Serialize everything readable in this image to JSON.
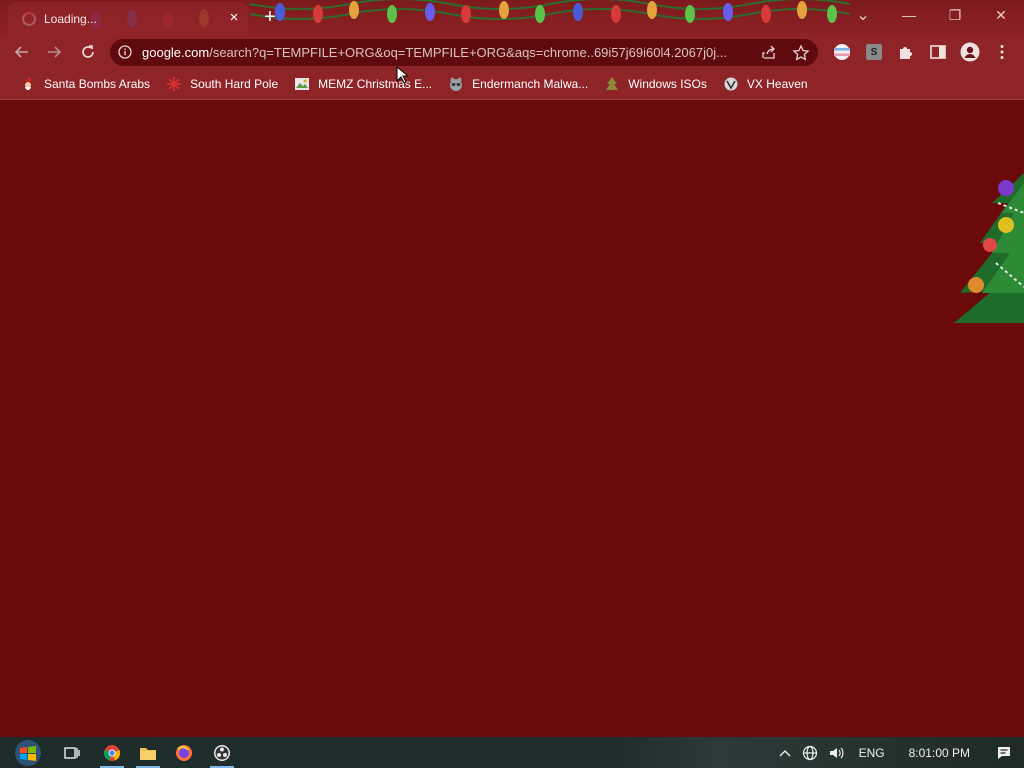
{
  "browser": {
    "tab": {
      "title": "Loading...",
      "close_glyph": "×"
    },
    "new_tab_glyph": "+",
    "window_controls": {
      "tab_search": "⌄",
      "minimize": "—",
      "restore": "❐",
      "close": "✕"
    },
    "address_bar": {
      "host": "google.com",
      "path": "/search?q=TEMPFILE+ORG&oq=TEMPFILE+ORG&aqs=chrome..69i57j69i60l4.2067j0j..."
    },
    "toolbar_icons": [
      "back-icon",
      "forward-icon",
      "stop-loading-icon",
      "site-info-icon",
      "share-icon",
      "bookmark-star-icon",
      "extension-flag-icon",
      "extension-s-icon",
      "extensions-puzzle-icon",
      "side-panel-icon",
      "profile-icon",
      "menu-icon"
    ],
    "extension_s_label": "S",
    "bookmarks": [
      {
        "label": "Santa Bombs Arabs",
        "icon": "santa-icon"
      },
      {
        "label": "South Hard Pole",
        "icon": "snowflake-icon"
      },
      {
        "label": "MEMZ Christmas E...",
        "icon": "image-icon"
      },
      {
        "label": "Endermanch Malwa...",
        "icon": "raccoon-icon"
      },
      {
        "label": "Windows ISOs",
        "icon": "tree-icon"
      },
      {
        "label": "VX Heaven",
        "icon": "vx-icon"
      }
    ]
  },
  "colors": {
    "page_background": "#6b0a0a",
    "toolbar": "#8e2428",
    "omnibox": "#5f0b0e",
    "title_strip": "#7d1a1c"
  },
  "taskbar": {
    "apps": [
      "windows-start-icon",
      "task-view-icon",
      "chrome-icon",
      "file-explorer-icon",
      "firefox-icon",
      "obs-icon"
    ],
    "tray": {
      "language": "ENG",
      "time": "8:01:00 PM"
    }
  }
}
